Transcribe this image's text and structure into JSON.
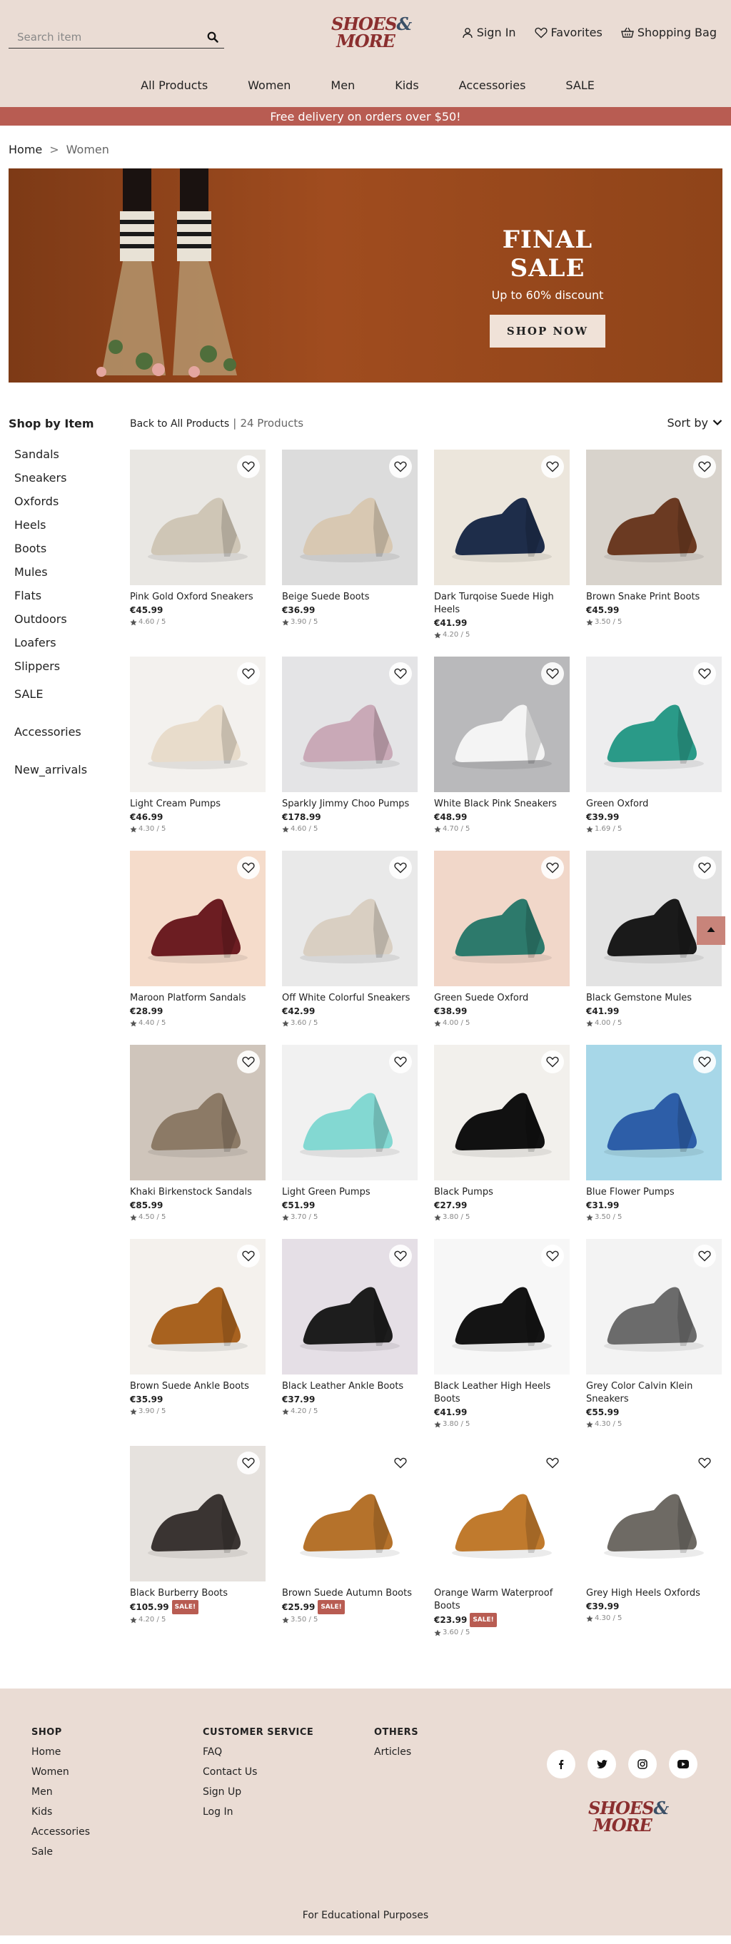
{
  "header": {
    "search_placeholder": "Search item",
    "logo_line1": "SHOES",
    "logo_amp": "&",
    "logo_line2": "MORE",
    "sign_in": "Sign In",
    "favorites": "Favorites",
    "shopping_bag": "Shopping Bag",
    "nav": [
      "All Products",
      "Women",
      "Men",
      "Kids",
      "Accessories",
      "SALE"
    ]
  },
  "promo": "Free delivery on orders over $50!",
  "breadcrumb": {
    "home": "Home",
    "sep": ">",
    "current": "Women"
  },
  "hero": {
    "title": "FINAL SALE",
    "subtitle": "Up to 60% discount",
    "button": "SHOP NOW"
  },
  "sidebar": {
    "title": "Shop by Item",
    "items": [
      "Sandals",
      "Sneakers",
      "Oxfords",
      "Heels",
      "Boots",
      "Mules",
      "Flats",
      "Outdoors",
      "Loafers",
      "Slippers"
    ],
    "sale": "SALE",
    "accessories": "Accessories",
    "new_arrivals": "New_arrivals"
  },
  "products_header": {
    "back": "Back to All Products",
    "divider": "|",
    "count": "24 Products",
    "sort": "Sort by"
  },
  "products": [
    {
      "name": "Pink Gold Oxford Sneakers",
      "price": "€45.99",
      "rating": "4.60 / 5",
      "sale": false,
      "colors": [
        "#e9e7e3",
        "#cfc6b6"
      ]
    },
    {
      "name": "Beige Suede Boots",
      "price": "€36.99",
      "rating": "3.90 / 5",
      "sale": false,
      "colors": [
        "#dcdcdc",
        "#d8c8b2"
      ]
    },
    {
      "name": "Dark Turqoise Suede High Heels",
      "price": "€41.99",
      "rating": "4.20 / 5",
      "sale": false,
      "colors": [
        "#ece6dc",
        "#1e2d4a"
      ]
    },
    {
      "name": "Brown Snake Print Boots",
      "price": "€45.99",
      "rating": "3.50 / 5",
      "sale": false,
      "colors": [
        "#d8d3cc",
        "#6b3a22"
      ]
    },
    {
      "name": "Light Cream Pumps",
      "price": "€46.99",
      "rating": "4.30 / 5",
      "sale": false,
      "colors": [
        "#f3f1ee",
        "#e8dccb"
      ]
    },
    {
      "name": "Sparkly Jimmy Choo Pumps",
      "price": "€178.99",
      "rating": "4.60 / 5",
      "sale": false,
      "colors": [
        "#e4e4e6",
        "#c9a9b7"
      ]
    },
    {
      "name": "White Black Pink Sneakers",
      "price": "€48.99",
      "rating": "4.70 / 5",
      "sale": false,
      "colors": [
        "#b9b9bb",
        "#f4f4f4"
      ]
    },
    {
      "name": "Green Oxford",
      "price": "€39.99",
      "rating": "1.69 / 5",
      "sale": false,
      "colors": [
        "#ededee",
        "#2a9a88"
      ]
    },
    {
      "name": "Maroon Platform Sandals",
      "price": "€28.99",
      "rating": "4.40 / 5",
      "sale": false,
      "colors": [
        "#f5dccb",
        "#6c1d22"
      ]
    },
    {
      "name": "Off White Colorful Sneakers",
      "price": "€42.99",
      "rating": "3.60 / 5",
      "sale": false,
      "colors": [
        "#e9e9e9",
        "#d9cfc2"
      ]
    },
    {
      "name": "Green Suede Oxford",
      "price": "€38.99",
      "rating": "4.00 / 5",
      "sale": false,
      "colors": [
        "#f1d7c9",
        "#2d7a6c"
      ]
    },
    {
      "name": "Black Gemstone Mules",
      "price": "€41.99",
      "rating": "4.00 / 5",
      "sale": false,
      "colors": [
        "#e3e3e3",
        "#1a1a1a"
      ]
    },
    {
      "name": "Khaki Birkenstock Sandals",
      "price": "€85.99",
      "rating": "4.50 / 5",
      "sale": false,
      "colors": [
        "#cfc5bb",
        "#8c7a66"
      ]
    },
    {
      "name": "Light Green Pumps",
      "price": "€51.99",
      "rating": "3.70 / 5",
      "sale": false,
      "colors": [
        "#f1f1f1",
        "#83d8d2"
      ]
    },
    {
      "name": "Black Pumps",
      "price": "€27.99",
      "rating": "3.80 / 5",
      "sale": false,
      "colors": [
        "#f2f0ec",
        "#111111"
      ]
    },
    {
      "name": "Blue Flower Pumps",
      "price": "€31.99",
      "rating": "3.50 / 5",
      "sale": false,
      "colors": [
        "#a7d7e8",
        "#2d5ea8"
      ]
    },
    {
      "name": "Brown Suede Ankle Boots",
      "price": "€35.99",
      "rating": "3.90 / 5",
      "sale": false,
      "colors": [
        "#f4f1ed",
        "#a8621f"
      ]
    },
    {
      "name": "Black Leather Ankle Boots",
      "price": "€37.99",
      "rating": "4.20 / 5",
      "sale": false,
      "colors": [
        "#e5dfe6",
        "#1d1d1d"
      ]
    },
    {
      "name": "Black Leather High Heels Boots",
      "price": "€41.99",
      "rating": "3.80 / 5",
      "sale": false,
      "colors": [
        "#f7f7f7",
        "#141414"
      ]
    },
    {
      "name": "Grey Color Calvin Klein Sneakers",
      "price": "€55.99",
      "rating": "4.30 / 5",
      "sale": false,
      "colors": [
        "#f3f3f3",
        "#6b6b6b"
      ]
    },
    {
      "name": "Black Burberry Boots",
      "price": "€105.99",
      "rating": "4.20 / 5",
      "sale": true,
      "sale_label": "SALE!",
      "colors": [
        "#e6e2de",
        "#3a3432"
      ]
    },
    {
      "name": "Brown Suede Autumn Boots",
      "price": "€25.99",
      "rating": "3.50 / 5",
      "sale": true,
      "sale_label": "SALE!",
      "colors": [
        "#ffffff",
        "#b5722b"
      ]
    },
    {
      "name": "Orange Warm Waterproof Boots",
      "price": "€23.99",
      "rating": "3.60 / 5",
      "sale": true,
      "sale_label": "SALE!",
      "colors": [
        "#ffffff",
        "#c07a2d"
      ]
    },
    {
      "name": "Grey High Heels Oxfords",
      "price": "€39.99",
      "rating": "4.30 / 5",
      "sale": false,
      "colors": [
        "#ffffff",
        "#6e6a64"
      ]
    }
  ],
  "footer": {
    "shop": {
      "title": "SHOP",
      "links": [
        "Home",
        "Women",
        "Men",
        "Kids",
        "Accessories",
        "Sale"
      ]
    },
    "service": {
      "title": "CUSTOMER SERVICE",
      "links": [
        "FAQ",
        "Contact Us",
        "Sign Up",
        "Log In"
      ]
    },
    "others": {
      "title": "OTHERS",
      "links": [
        "Articles"
      ]
    },
    "socials": [
      "facebook-icon",
      "twitter-icon",
      "instagram-icon",
      "youtube-icon"
    ],
    "note": "For Educational Purposes"
  },
  "colors": {
    "header_bg": "#eadcd4",
    "accent": "#b85c52",
    "logo": "#8b2f2f"
  }
}
